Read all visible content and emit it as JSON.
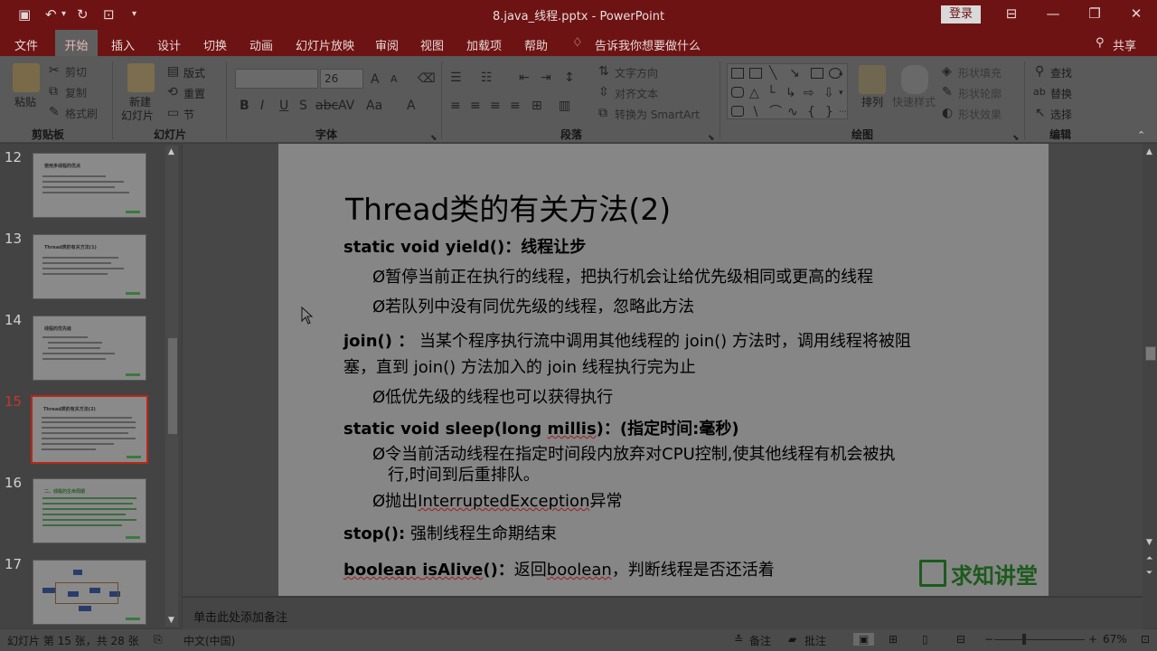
{
  "titlebar": {
    "doc_title": "8.java_线程.pptx - PowerPoint",
    "login": "登录",
    "icons": [
      "save-icon",
      "undo-icon",
      "redo-icon",
      "present-icon",
      "customize-icon"
    ]
  },
  "tabs": [
    "文件",
    "开始",
    "插入",
    "设计",
    "切换",
    "动画",
    "幻灯片放映",
    "审阅",
    "视图",
    "加载项",
    "帮助"
  ],
  "tell_me": "告诉我你想要做什么",
  "share": "共享",
  "ribbon": {
    "clipboard": {
      "paste": "粘贴",
      "cut": "剪切",
      "copy": "复制",
      "format_painter": "格式刷",
      "group": "剪贴板"
    },
    "slides": {
      "new_slide_1": "新建",
      "new_slide_2": "幻灯片",
      "layout": "版式",
      "reset": "重置",
      "section": "节",
      "group": "幻灯片"
    },
    "font": {
      "font_size": "26",
      "group": "字体"
    },
    "paragraph": {
      "text_direction": "文字方向",
      "align_text": "对齐文本",
      "smartart": "转换为 SmartArt",
      "group": "段落"
    },
    "drawing": {
      "arrange": "排列",
      "quick_styles": "快速样式",
      "shape_fill": "形状填充",
      "shape_outline": "形状轮廓",
      "shape_effects": "形状效果",
      "group": "绘图"
    },
    "editing": {
      "find": "查找",
      "replace": "替换",
      "select": "选择",
      "group": "编辑"
    }
  },
  "thumbnails": [
    {
      "num": "12",
      "title": "使用多线程的优点"
    },
    {
      "num": "13",
      "title": "Thread类的有关方法(1)"
    },
    {
      "num": "14",
      "title": "线程的优先级"
    },
    {
      "num": "15",
      "title": "Thread类的有关方法(2)"
    },
    {
      "num": "16",
      "title": "二、线程的生命周期"
    },
    {
      "num": "17",
      "title": ""
    }
  ],
  "slide": {
    "title": "Thread类的有关方法(2)",
    "yield_head": "static  void  yield()：线程让步",
    "yield_1": "Ø暂停当前正在执行的线程，把执行机会让给优先级相同或更高的线程",
    "yield_2": "Ø若队列中没有同优先级的线程，忽略此方法",
    "join_a": "join() ：",
    "join_b": " 当某个程序执行流中调用其他线程的 join() 方法时，调用线程将被阻",
    "join_c": "塞，直到 join() 方法加入的 join 线程执行完为止",
    "join_1": "Ø低优先级的线程也可以获得执行",
    "sleep_head_a": "static  void  sleep(long ",
    "sleep_head_u": "millis",
    "sleep_head_b": ")：(指定时间:毫秒)",
    "sleep_1a": "Ø令当前活动线程在指定时间段内放弃对CPU控制,使其他线程有机会被执",
    "sleep_1b": "行,时间到后重排队。",
    "sleep_2a": "Ø抛出",
    "sleep_2u": "InterruptedException",
    "sleep_2b": "异常",
    "stop_a": "stop():",
    "stop_b": " 强制线程生命期结束",
    "alive_a": "boolean ",
    "alive_u": "isAlive",
    "alive_b": "()：",
    "alive_c": "返回",
    "alive_u2": "boolean",
    "alive_d": "，判断线程是否还活着",
    "brand": "求知讲堂"
  },
  "notes_placeholder": "单击此处添加备注",
  "status": {
    "slide_info": "幻灯片 第 15 张，共 28 张",
    "language": "中文(中国)",
    "notes": "备注",
    "comments": "批注",
    "zoom": "67%"
  }
}
